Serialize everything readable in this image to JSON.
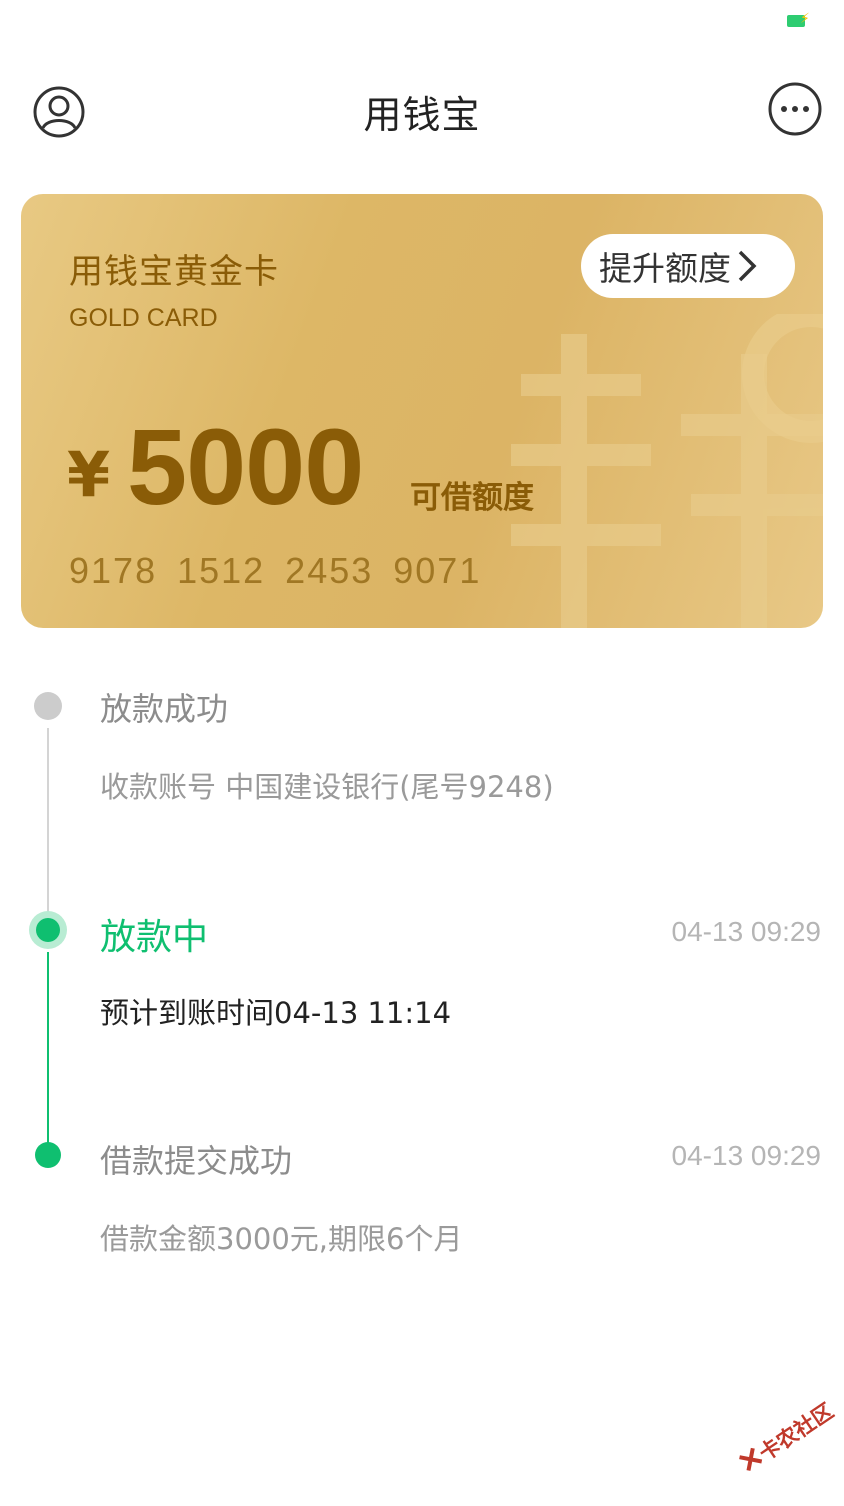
{
  "status_bar": {
    "battery_color": "#2ecc71",
    "icons": [
      "battery-charging-icon"
    ]
  },
  "header": {
    "title": "用钱宝",
    "left_icon": "user-profile-icon",
    "right_icon": "more-options-icon"
  },
  "card": {
    "title": "用钱宝黄金卡",
    "subtitle": "GOLD CARD",
    "raise_button_label": "提升额度",
    "currency": "¥",
    "amount": "5000",
    "amount_label": "可借额度",
    "card_number": "9178  1512  2453  9071",
    "text_color": "#8a5c07"
  },
  "timeline": {
    "steps": [
      {
        "title": "放款成功",
        "description": "收款账号 中国建设银行(尾号9248)",
        "time": "",
        "state": "pending"
      },
      {
        "title": "放款中",
        "description": "预计到账时间04-13 11:14",
        "time": "04-13 09:29",
        "state": "active"
      },
      {
        "title": "借款提交成功",
        "description": "借款金额3000元,期限6个月",
        "time": "04-13 09:29",
        "state": "done"
      }
    ],
    "accent_color": "#0fbf70"
  },
  "watermark": {
    "text": "卡农社区"
  }
}
